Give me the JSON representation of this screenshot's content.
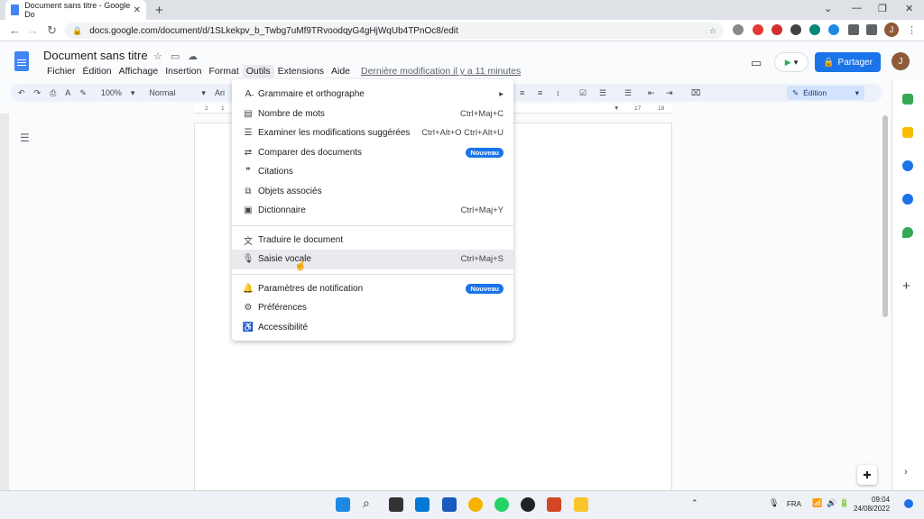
{
  "browser": {
    "tab_title": "Document sans titre - Google Do",
    "url": "docs.google.com/document/d/1SLkekpv_b_Twbg7uMf9TRvoodqyG4gHjWqUb4TPnOc8/edit",
    "profile_initial": "J"
  },
  "docs": {
    "title": "Document sans titre",
    "menu": [
      "Fichier",
      "Édition",
      "Affichage",
      "Insertion",
      "Format",
      "Outils",
      "Extensions",
      "Aide"
    ],
    "active_menu": "Outils",
    "last_edit": "Dernière modification il y a 11 minutes",
    "share_label": "Partager",
    "user_initial": "J"
  },
  "toolbar": {
    "zoom": "100%",
    "style": "Normal",
    "font": "Ari",
    "mode": "Édition"
  },
  "ruler": {
    "labels": [
      "2",
      "1",
      "2",
      "16",
      "17",
      "18"
    ]
  },
  "tools_menu": {
    "items": [
      {
        "icon": "spellcheck-icon",
        "glyph": "A̶",
        "label": "Grammaire et orthographe",
        "shortcut": "",
        "submenu": true
      },
      {
        "icon": "word-count-icon",
        "glyph": "▤",
        "label": "Nombre de mots",
        "shortcut": "Ctrl+Maj+C"
      },
      {
        "icon": "review-suggestions-icon",
        "glyph": "☰",
        "label": "Examiner les modifications suggérées",
        "shortcut": "Ctrl+Alt+O Ctrl+Alt+U"
      },
      {
        "icon": "compare-icon",
        "glyph": "⇄",
        "label": "Comparer des documents",
        "badge": "Nouveau"
      },
      {
        "icon": "quote-icon",
        "glyph": "❞",
        "label": "Citations",
        "shortcut": ""
      },
      {
        "icon": "linked-objects-icon",
        "glyph": "⧉",
        "label": "Objets associés",
        "shortcut": ""
      },
      {
        "icon": "dictionary-icon",
        "glyph": "▣",
        "label": "Dictionnaire",
        "shortcut": "Ctrl+Maj+Y"
      },
      {
        "separator": true
      },
      {
        "icon": "translate-icon",
        "glyph": "文",
        "label": "Traduire le document",
        "shortcut": ""
      },
      {
        "icon": "microphone-icon",
        "glyph": "🎙",
        "label": "Saisie vocale",
        "shortcut": "Ctrl+Maj+S",
        "highlighted": true
      },
      {
        "separator": true
      },
      {
        "icon": "bell-icon",
        "glyph": "🔔",
        "label": "Paramètres de notification",
        "badge": "Nouveau"
      },
      {
        "icon": "preferences-icon",
        "glyph": "⚙",
        "label": "Préférences",
        "shortcut": ""
      },
      {
        "icon": "accessibility-icon",
        "glyph": "♿",
        "label": "Accessibilité",
        "shortcut": ""
      }
    ]
  },
  "taskbar": {
    "language": "FRA",
    "time": "09:04",
    "date": "24/08/2022"
  },
  "colors": {
    "accent": "#1a73e8",
    "docs_blue": "#4285f4"
  }
}
